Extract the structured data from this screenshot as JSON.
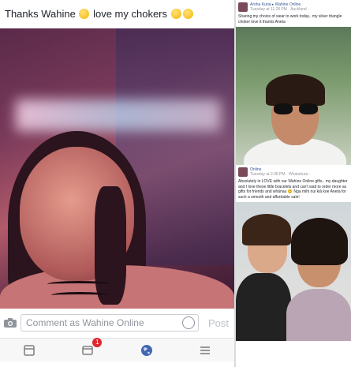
{
  "left_post": {
    "caption_text": "Thanks Wahine",
    "caption_text2": "love my chokers",
    "comment_placeholder": "Comment as Wahine Online",
    "post_label": "Post"
  },
  "nav": {
    "notifications_badge": "1"
  },
  "right_panel": {
    "post1": {
      "author": "Aroha Kuria ▸ Wahine Online",
      "meta": "Tuesday at 11:28 PM · Auckland ·",
      "text": "Sharing my choice of wear to work today.. my silver triangle choker love it thanks Aneta"
    },
    "post2": {
      "author": "Online",
      "meta": "Tuesday at 2:38 PM · Whatukura ·",
      "text": "Absolutely in LOVE with our Wahine Online gifts.. my daughter and I love these little bracelets and can't wait to order more as gifts for friends and whānau 😊 Nga mihi nui kiā koe Aneta for such a smooth and affordable sale!"
    }
  },
  "colors": {
    "fb_blue": "#365899",
    "badge_red": "#e0262e",
    "muted_grey": "#90949c"
  }
}
